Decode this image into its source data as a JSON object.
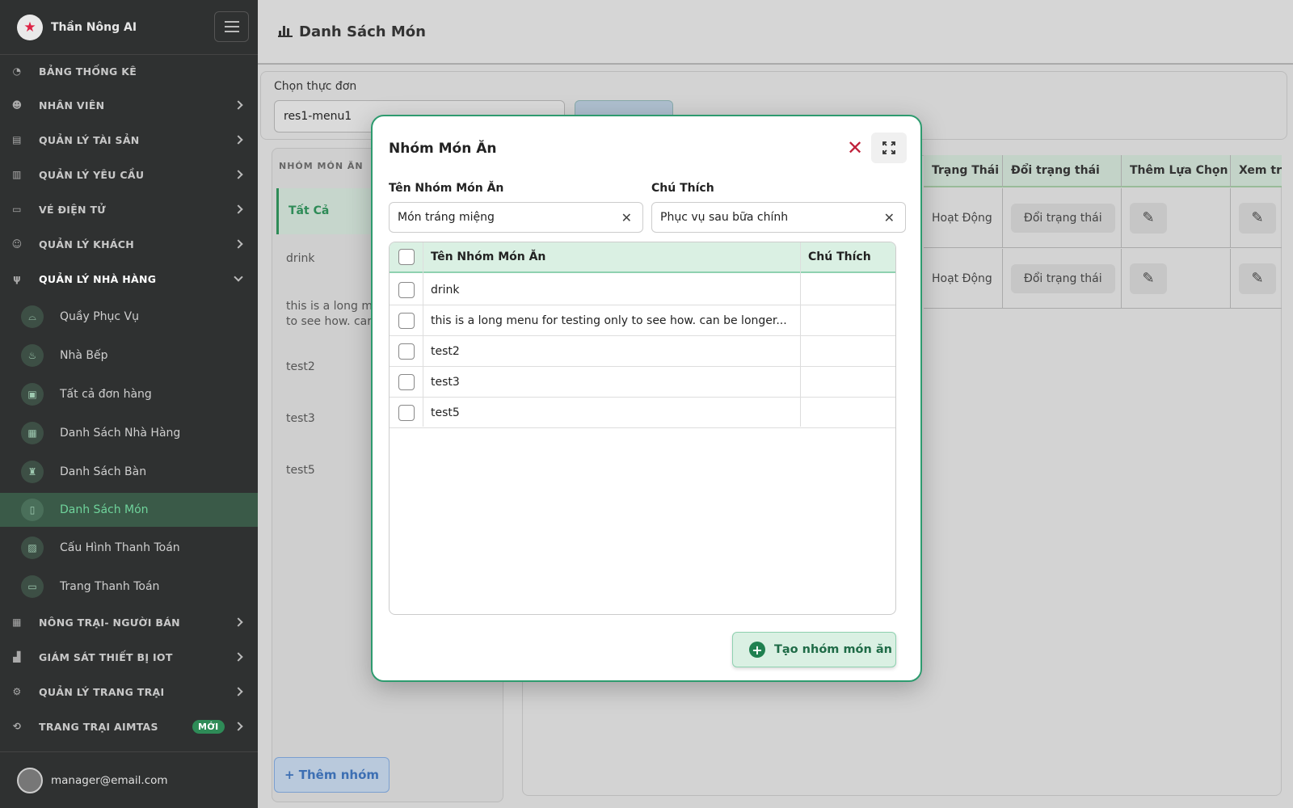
{
  "sidebar": {
    "brand": "Thần Nông AI",
    "items": [
      {
        "label": "BẢNG THỐNG KÊ",
        "icon": "◔"
      },
      {
        "label": "NHÂN VIÊN",
        "icon": "☻"
      },
      {
        "label": "QUẢN LÝ TÀI SẢN",
        "icon": "▤"
      },
      {
        "label": "QUẢN LÝ YÊU CẦU",
        "icon": "▥"
      },
      {
        "label": "VÉ ĐIỆN TỬ",
        "icon": "▭"
      },
      {
        "label": "QUẢN LÝ KHÁCH",
        "icon": "☺"
      },
      {
        "label": "QUẢN LÝ NHÀ HÀNG",
        "icon": "ψ"
      },
      {
        "label": "NÔNG TRẠI- NGƯỜI BÁN",
        "icon": "▦"
      },
      {
        "label": "GIÁM SÁT THIẾT BỊ IOT",
        "icon": "▟"
      },
      {
        "label": "QUẢN LÝ TRANG TRẠI",
        "icon": "⚙"
      },
      {
        "label": "TRANG TRẠI AIMTAS",
        "icon": "⟲",
        "badge": "MỚI"
      }
    ],
    "sub_items": [
      {
        "label": "Quầy Phục Vụ",
        "icon": "⌓"
      },
      {
        "label": "Nhà Bếp",
        "icon": "♨"
      },
      {
        "label": "Tất cả đơn hàng",
        "icon": "▣"
      },
      {
        "label": "Danh Sách Nhà Hàng",
        "icon": "▦"
      },
      {
        "label": "Danh Sách Bàn",
        "icon": "♜"
      },
      {
        "label": "Danh Sách Món",
        "icon": "▯"
      },
      {
        "label": "Cấu Hình Thanh Toán",
        "icon": "▨"
      },
      {
        "label": "Trang Thanh Toán",
        "icon": "▭"
      }
    ],
    "user_email": "manager@email.com"
  },
  "header": {
    "title": "Danh Sách Món"
  },
  "menu_select": {
    "label": "Chọn thực đơn",
    "value": "res1-menu1"
  },
  "groups": {
    "heading": "NHÓM MÓN ĂN",
    "items": [
      "Tất Cả",
      "drink",
      "this is a long m\nto see how. car",
      "test2",
      "test3",
      "test5"
    ],
    "add_button": "+ Thêm nhóm"
  },
  "bg_table": {
    "headers": [
      "Trạng Thái",
      "Đổi trạng thái",
      "Thêm Lựa Chọn",
      "Xem trư"
    ],
    "rows": [
      {
        "status": "Hoạt Động",
        "toggle": "Đổi trạng thái"
      },
      {
        "status": "Hoạt Động",
        "toggle": "Đổi trạng thái"
      }
    ]
  },
  "modal": {
    "title": "Nhóm Món Ăn",
    "name_label": "Tên Nhóm Món Ăn",
    "name_value": "Món tráng miệng",
    "note_label": "Chú Thích",
    "note_value": "Phục vụ sau bữa chính",
    "table_headers": [
      "Tên Nhóm Món Ăn",
      "Chú Thích"
    ],
    "rows": [
      {
        "name": "drink",
        "note": ""
      },
      {
        "name": "this is a long menu for testing only to see how. can be longer...",
        "note": ""
      },
      {
        "name": "test2",
        "note": ""
      },
      {
        "name": "test3",
        "note": ""
      },
      {
        "name": "test5",
        "note": ""
      }
    ],
    "create_button": "Tạo nhóm món ăn"
  },
  "colors": {
    "accent": "#2e8b57",
    "close": "#c0203a"
  }
}
